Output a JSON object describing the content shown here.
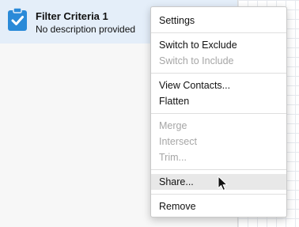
{
  "filter": {
    "title": "Filter Criteria 1",
    "description": "No description provided",
    "icon": "clipboard-check-icon",
    "accent_color": "#2a8ad8"
  },
  "menu": {
    "settings": "Settings",
    "switch_to_exclude": "Switch to Exclude",
    "switch_to_include": "Switch to Include",
    "view_contacts": "View Contacts...",
    "flatten": "Flatten",
    "merge": "Merge",
    "intersect": "Intersect",
    "trim": "Trim...",
    "share": "Share...",
    "remove": "Remove"
  },
  "colors": {
    "selected_row": "#e4eef9",
    "disabled_text": "#a6a6a6",
    "hover_item": "#e8e8e8"
  }
}
